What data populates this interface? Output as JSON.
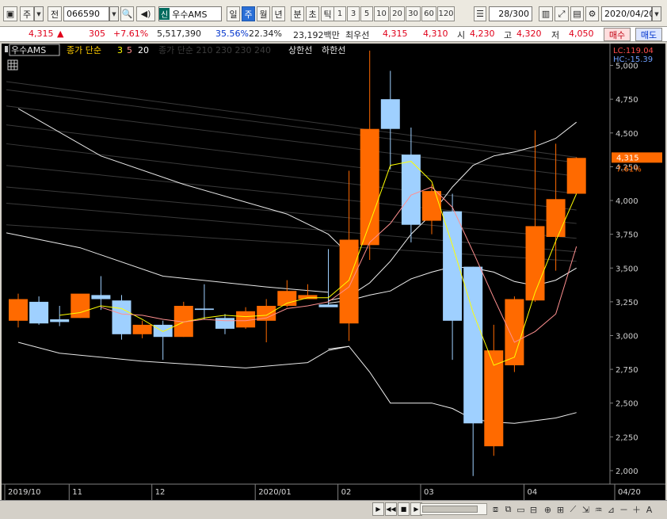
{
  "toolbar": {
    "mode_label": "주",
    "jeon_label": "전",
    "stock_code": "066590",
    "stock_badge": "신",
    "stock_name": "우수AMS",
    "period_tabs": [
      "일",
      "주",
      "월",
      "년",
      "분",
      "초",
      "틱"
    ],
    "active_period": "주",
    "number_tabs": [
      "1",
      "3",
      "5",
      "10",
      "20",
      "30",
      "60",
      "120"
    ],
    "count": "28/300",
    "date": "2020/04/20"
  },
  "quote": {
    "price": "4,315",
    "change_arrow": "▲",
    "change": "305",
    "change_pct": "+7.61%",
    "volume": "5,517,390",
    "vol_ratio": "35.56%",
    "turnover": "22.34%",
    "amount": "23,192백만",
    "best_ask_label": "최우선",
    "best_ask": "4,315",
    "best_bid": "4,310",
    "open_label": "시",
    "open": "4,230",
    "high_label": "고",
    "high": "4,320",
    "low_label": "저",
    "low": "4,050",
    "buy_label": "매수",
    "sell_label": "매도"
  },
  "legend": {
    "stock": "우수AMS",
    "ma_label": "종가 단순",
    "ma_periods": [
      "3",
      "5",
      "20"
    ],
    "ma2_label": "종가 단순",
    "ma2_periods": [
      "210",
      "230",
      "230",
      "240"
    ],
    "upper_label": "상한선",
    "lower_label": "하한선"
  },
  "overlay": {
    "lc": "LC:119.04",
    "hc": "HC:-15.39",
    "price_tag": "4,315",
    "pct_tag": "7.61%"
  },
  "colors": {
    "up": "#ff6a00",
    "down": "#9fd0ff",
    "ma3": "#ffff00",
    "ma5": "#ff9090",
    "band": "#f0f0f0"
  },
  "chart_data": {
    "type": "candlestick",
    "period": "weekly",
    "ylim": [
      1900,
      5150
    ],
    "yticks": [
      2000,
      2250,
      2500,
      2750,
      3000,
      3250,
      3500,
      3750,
      4000,
      4250,
      4500,
      4750,
      5000
    ],
    "ytick_labels": [
      "2,000",
      "2,250",
      "2,500",
      "2,750",
      "3,000",
      "3,250",
      "3,500",
      "3,750",
      "4,000",
      "4,250",
      "4,500",
      "4,750",
      "5,000"
    ],
    "xtick_labels": [
      {
        "label": "2019/10",
        "index": 0
      },
      {
        "label": "11",
        "index": 3
      },
      {
        "label": "12",
        "index": 7
      },
      {
        "label": "2020/01",
        "index": 12
      },
      {
        "label": "02",
        "index": 16
      },
      {
        "label": "03",
        "index": 20
      },
      {
        "label": "04",
        "index": 25
      },
      {
        "label": "04/20",
        "index": 29
      }
    ],
    "candles": [
      {
        "o": 3110,
        "h": 3310,
        "l": 3060,
        "c": 3270
      },
      {
        "o": 3250,
        "h": 3290,
        "l": 3080,
        "c": 3090
      },
      {
        "o": 3120,
        "h": 3220,
        "l": 3070,
        "c": 3100
      },
      {
        "o": 3130,
        "h": 3280,
        "l": 3130,
        "c": 3310
      },
      {
        "o": 3300,
        "h": 3440,
        "l": 3190,
        "c": 3270
      },
      {
        "o": 3260,
        "h": 3300,
        "l": 2970,
        "c": 3010
      },
      {
        "o": 3010,
        "h": 3110,
        "l": 2980,
        "c": 3080
      },
      {
        "o": 3080,
        "h": 3110,
        "l": 2820,
        "c": 2990
      },
      {
        "o": 2990,
        "h": 3250,
        "l": 2990,
        "c": 3220
      },
      {
        "o": 3200,
        "h": 3380,
        "l": 3120,
        "c": 3190
      },
      {
        "o": 3130,
        "h": 3160,
        "l": 3010,
        "c": 3050
      },
      {
        "o": 3060,
        "h": 3210,
        "l": 3050,
        "c": 3180
      },
      {
        "o": 3110,
        "h": 3270,
        "l": 2950,
        "c": 3220
      },
      {
        "o": 3220,
        "h": 3410,
        "l": 3210,
        "c": 3330
      },
      {
        "o": 3270,
        "h": 3380,
        "l": 3270,
        "c": 3300
      },
      {
        "o": 3230,
        "h": 3640,
        "l": 3220,
        "c": 3210
      },
      {
        "o": 3090,
        "h": 4220,
        "l": 2960,
        "c": 3710
      },
      {
        "o": 3670,
        "h": 5110,
        "l": 3560,
        "c": 4530
      },
      {
        "o": 4750,
        "h": 4960,
        "l": 4230,
        "c": 4530
      },
      {
        "o": 4340,
        "h": 4540,
        "l": 3690,
        "c": 3820
      },
      {
        "o": 3850,
        "h": 4120,
        "l": 3750,
        "c": 4070
      },
      {
        "o": 3920,
        "h": 4050,
        "l": 2820,
        "c": 3110
      },
      {
        "o": 3510,
        "h": 3510,
        "l": 1960,
        "c": 2350
      },
      {
        "o": 2180,
        "h": 3080,
        "l": 2110,
        "c": 2890
      },
      {
        "o": 2780,
        "h": 3290,
        "l": 2730,
        "c": 3270
      },
      {
        "o": 3260,
        "h": 4520,
        "l": 3250,
        "c": 3810
      },
      {
        "o": 3730,
        "h": 4420,
        "l": 3480,
        "c": 4010
      },
      {
        "o": 4050,
        "h": 4320,
        "l": 4050,
        "c": 4315
      }
    ],
    "series": [
      {
        "name": "3",
        "values": [
          null,
          null,
          3150,
          3170,
          3220,
          3200,
          3120,
          3030,
          3100,
          3130,
          3150,
          3140,
          3150,
          3240,
          3280,
          3280,
          3410,
          3830,
          4260,
          4290,
          4140,
          3670,
          3170,
          2780,
          2840,
          3320,
          3700,
          4050
        ]
      },
      {
        "name": "5",
        "values": [
          null,
          null,
          null,
          null,
          3210,
          3160,
          3150,
          3120,
          3100,
          3120,
          3110,
          3110,
          3130,
          3200,
          3220,
          3250,
          3360,
          3690,
          3830,
          4040,
          4100,
          3950,
          3620,
          3280,
          2950,
          3030,
          3160,
          3660
        ]
      },
      {
        "name": "upper",
        "values": [
          null,
          null,
          null,
          null,
          null,
          null,
          null,
          null,
          null,
          null,
          null,
          null,
          null,
          null,
          null,
          3260,
          3290,
          3390,
          3550,
          3750,
          3900,
          4100,
          4260,
          4330,
          4360,
          4400,
          4460,
          4580
        ]
      },
      {
        "name": "mid",
        "values": [
          null,
          null,
          null,
          null,
          null,
          null,
          null,
          null,
          null,
          null,
          null,
          null,
          null,
          null,
          null,
          3240,
          3260,
          3300,
          3330,
          3420,
          3470,
          3510,
          3500,
          3470,
          3400,
          3370,
          3410,
          3500
        ]
      },
      {
        "name": "lower",
        "values": [
          null,
          null,
          null,
          null,
          null,
          null,
          null,
          null,
          null,
          null,
          null,
          null,
          null,
          null,
          null,
          2900,
          2920,
          2730,
          2500,
          2500,
          2500,
          2460,
          2380,
          2360,
          2350,
          2370,
          2390,
          2430
        ]
      }
    ]
  }
}
